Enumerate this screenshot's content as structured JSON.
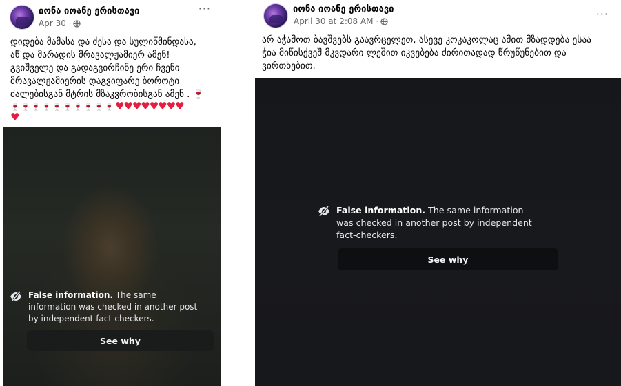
{
  "posts": [
    {
      "author": "იონა იოანე ერისთავი",
      "timestamp": "Apr 30 ·",
      "more_label": "···",
      "text_lines": [
        "დიდება მამასა და ძესა და სულიწმინდასა,",
        "აწ და მარადის მრავალჟამიერ ამენ!",
        "გვიშველე და გადაგვირჩინე ერი ჩვენი",
        "მრავალჟამიერის დაგვიფარე ბოროტი",
        "ძალებისგან მტრის მზაკვრობისგან ამენ ."
      ],
      "emoji_glasses": "🍷 🍷 🍷 🍷 🍷 🍷 🍷 🍷 🍷 🍷",
      "emoji_hearts": "♥♥♥♥♥♥♥♥",
      "emoji_last": "♥",
      "warning_title": "False information.",
      "warning_body": "The same information was checked in another post by independent fact-checkers.",
      "see_why_label": "See why"
    },
    {
      "author": "იონა იოანე ერისთავი",
      "timestamp": "April 30 at 2:08 AM ·",
      "more_label": "···",
      "text_lines": [
        "არ აჭამოთ ბავშვებს გაავრცელეთ, ასევე კოკაკოლაც ამით მზადდება ესაა",
        "ჭია მიწისქვეშ მკვდარი ლეშით იკვებება ძირითადად წრუწუნებით და",
        "ვირთხებით."
      ],
      "warning_title": "False information.",
      "warning_body": "The same information was checked in another post by independent fact-checkers.",
      "see_why_label": "See why"
    }
  ],
  "icons": {
    "privacy": "globe-icon",
    "warning": "eye-slash-icon",
    "menu": "more-horizontal-icon"
  },
  "colors": {
    "text": "#050505",
    "secondary_text": "#65676b",
    "overlay_text": "#e4e6eb",
    "button_bg": "#0e0f11",
    "heart": "#e41e3f",
    "wine": "#b0102a"
  }
}
